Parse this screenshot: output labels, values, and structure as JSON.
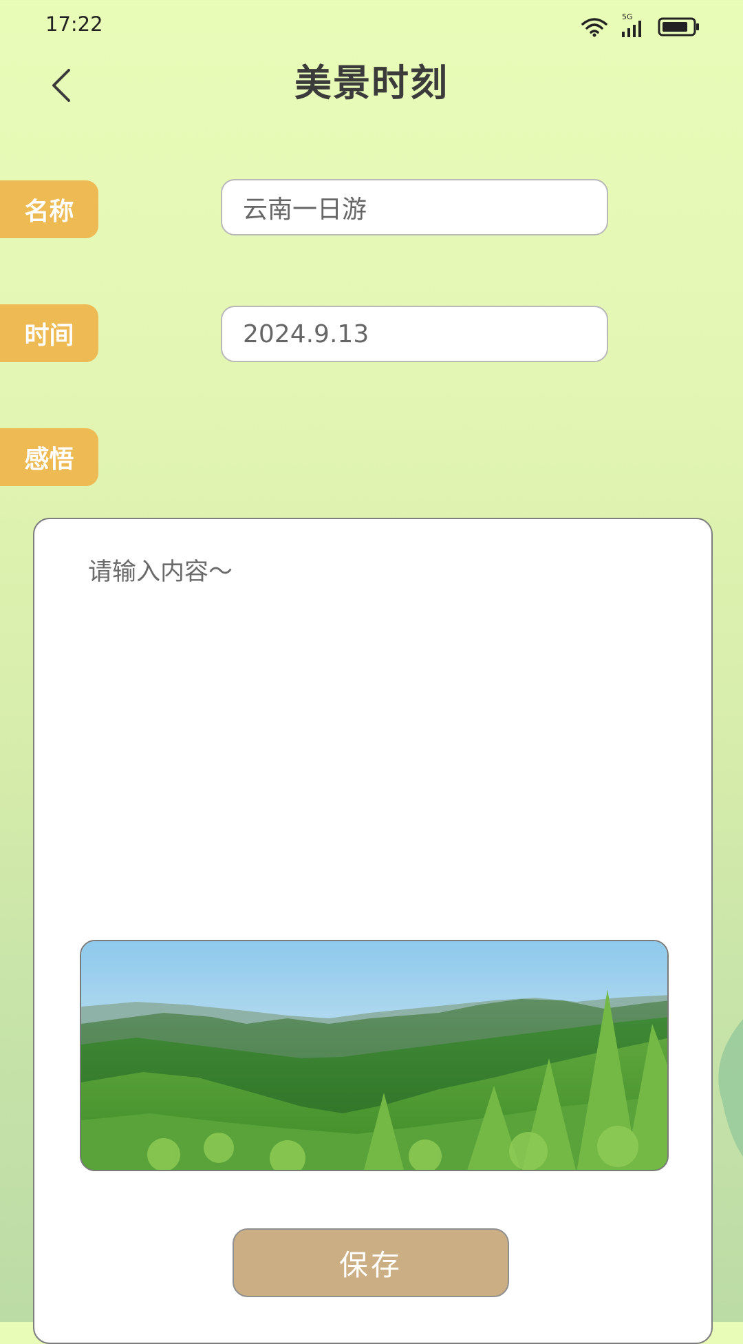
{
  "status_bar": {
    "time": "17:22",
    "network": "5G"
  },
  "header": {
    "title": "美景时刻"
  },
  "form": {
    "name_label": "名称",
    "name_value": "云南一日游",
    "time_label": "时间",
    "time_value": "2024.9.13",
    "thought_label": "感悟",
    "content_placeholder": "请输入内容～"
  },
  "actions": {
    "save_label": "保存"
  },
  "colors": {
    "label_bg": "#edba54",
    "save_bg": "#cbae84",
    "background_top": "#e8fcb8",
    "background_bottom": "#bcdca6"
  },
  "icons": [
    "back-arrow-icon",
    "wifi-icon",
    "signal-icon",
    "battery-icon"
  ]
}
